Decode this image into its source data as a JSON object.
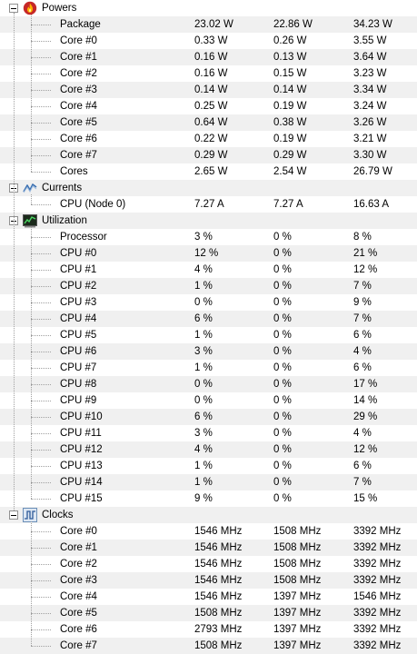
{
  "groups": [
    {
      "id": "powers",
      "label": "Powers",
      "icon": "flame-icon",
      "rows": [
        {
          "label": "Package",
          "v1": "23.02 W",
          "v2": "22.86 W",
          "v3": "34.23 W"
        },
        {
          "label": "Core #0",
          "v1": "0.33 W",
          "v2": "0.26 W",
          "v3": "3.55 W"
        },
        {
          "label": "Core #1",
          "v1": "0.16 W",
          "v2": "0.13 W",
          "v3": "3.64 W"
        },
        {
          "label": "Core #2",
          "v1": "0.16 W",
          "v2": "0.15 W",
          "v3": "3.23 W"
        },
        {
          "label": "Core #3",
          "v1": "0.14 W",
          "v2": "0.14 W",
          "v3": "3.34 W"
        },
        {
          "label": "Core #4",
          "v1": "0.25 W",
          "v2": "0.19 W",
          "v3": "3.24 W"
        },
        {
          "label": "Core #5",
          "v1": "0.64 W",
          "v2": "0.38 W",
          "v3": "3.26 W"
        },
        {
          "label": "Core #6",
          "v1": "0.22 W",
          "v2": "0.19 W",
          "v3": "3.21 W"
        },
        {
          "label": "Core #7",
          "v1": "0.29 W",
          "v2": "0.29 W",
          "v3": "3.30 W"
        },
        {
          "label": "Cores",
          "v1": "2.65 W",
          "v2": "2.54 W",
          "v3": "26.79 W"
        }
      ]
    },
    {
      "id": "currents",
      "label": "Currents",
      "icon": "current-wave-icon",
      "rows": [
        {
          "label": "CPU (Node 0)",
          "v1": "7.27 A",
          "v2": "7.27 A",
          "v3": "16.63 A"
        }
      ]
    },
    {
      "id": "utilization",
      "label": "Utilization",
      "icon": "utilization-monitor-icon",
      "rows": [
        {
          "label": "Processor",
          "v1": "3 %",
          "v2": "0 %",
          "v3": "8 %"
        },
        {
          "label": "CPU #0",
          "v1": "12 %",
          "v2": "0 %",
          "v3": "21 %"
        },
        {
          "label": "CPU #1",
          "v1": "4 %",
          "v2": "0 %",
          "v3": "12 %"
        },
        {
          "label": "CPU #2",
          "v1": "1 %",
          "v2": "0 %",
          "v3": "7 %"
        },
        {
          "label": "CPU #3",
          "v1": "0 %",
          "v2": "0 %",
          "v3": "9 %"
        },
        {
          "label": "CPU #4",
          "v1": "6 %",
          "v2": "0 %",
          "v3": "7 %"
        },
        {
          "label": "CPU #5",
          "v1": "1 %",
          "v2": "0 %",
          "v3": "6 %"
        },
        {
          "label": "CPU #6",
          "v1": "3 %",
          "v2": "0 %",
          "v3": "4 %"
        },
        {
          "label": "CPU #7",
          "v1": "1 %",
          "v2": "0 %",
          "v3": "6 %"
        },
        {
          "label": "CPU #8",
          "v1": "0 %",
          "v2": "0 %",
          "v3": "17 %"
        },
        {
          "label": "CPU #9",
          "v1": "0 %",
          "v2": "0 %",
          "v3": "14 %"
        },
        {
          "label": "CPU #10",
          "v1": "6 %",
          "v2": "0 %",
          "v3": "29 %"
        },
        {
          "label": "CPU #11",
          "v1": "3 %",
          "v2": "0 %",
          "v3": "4 %"
        },
        {
          "label": "CPU #12",
          "v1": "4 %",
          "v2": "0 %",
          "v3": "12 %"
        },
        {
          "label": "CPU #13",
          "v1": "1 %",
          "v2": "0 %",
          "v3": "6 %"
        },
        {
          "label": "CPU #14",
          "v1": "1 %",
          "v2": "0 %",
          "v3": "7 %"
        },
        {
          "label": "CPU #15",
          "v1": "9 %",
          "v2": "0 %",
          "v3": "15 %"
        }
      ]
    },
    {
      "id": "clocks",
      "label": "Clocks",
      "icon": "clock-square-wave-icon",
      "rows": [
        {
          "label": "Core #0",
          "v1": "1546 MHz",
          "v2": "1508 MHz",
          "v3": "3392 MHz"
        },
        {
          "label": "Core #1",
          "v1": "1546 MHz",
          "v2": "1508 MHz",
          "v3": "3392 MHz"
        },
        {
          "label": "Core #2",
          "v1": "1546 MHz",
          "v2": "1508 MHz",
          "v3": "3392 MHz"
        },
        {
          "label": "Core #3",
          "v1": "1546 MHz",
          "v2": "1508 MHz",
          "v3": "3392 MHz"
        },
        {
          "label": "Core #4",
          "v1": "1546 MHz",
          "v2": "1397 MHz",
          "v3": "1546 MHz"
        },
        {
          "label": "Core #5",
          "v1": "1508 MHz",
          "v2": "1397 MHz",
          "v3": "3392 MHz"
        },
        {
          "label": "Core #6",
          "v1": "2793 MHz",
          "v2": "1397 MHz",
          "v3": "3392 MHz"
        },
        {
          "label": "Core #7",
          "v1": "1508 MHz",
          "v2": "1397 MHz",
          "v3": "3392 MHz"
        }
      ]
    }
  ],
  "colors": {
    "alt_row": "#f0f0f0",
    "tree_line": "#a0a0a0"
  }
}
